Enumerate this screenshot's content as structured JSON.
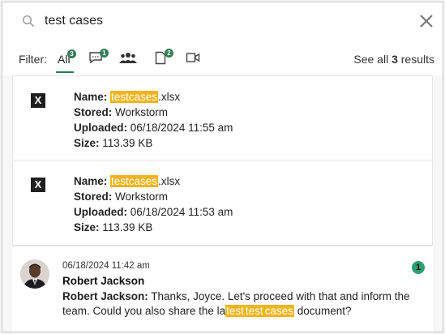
{
  "search": {
    "query": "test cases"
  },
  "filter": {
    "label": "Filter:",
    "all_label": "All",
    "all_count": "3",
    "messages_count": "1",
    "files_count": "2",
    "see_all_prefix": "See all",
    "see_all_count": "3",
    "see_all_suffix": "results"
  },
  "files": [
    {
      "name_label": "Name:",
      "name_highlight": "testcases",
      "name_ext": ".xlsx",
      "stored_label": "Stored:",
      "stored_value": "Workstorm",
      "uploaded_label": "Uploaded:",
      "uploaded_value": "06/18/2024 11:55 am",
      "size_label": "Size:",
      "size_value": "113.39 KB"
    },
    {
      "name_label": "Name:",
      "name_highlight": "testcases",
      "name_ext": ".xlsx",
      "stored_label": "Stored:",
      "stored_value": "Workstorm",
      "uploaded_label": "Uploaded:",
      "uploaded_value": "06/18/2024 11:53 am",
      "size_label": "Size:",
      "size_value": "113.39 KB"
    }
  ],
  "message": {
    "timestamp": "06/18/2024 11:42 am",
    "sender": "Robert Jackson",
    "body_sender": "Robert Jackson:",
    "body_text": "Thanks, Joyce. Let's proceed with that and inform the team. Could you also share the la",
    "body_hl1": "test",
    "body_hl2": "test",
    "body_hl3": "cases",
    "body_tail": "document?",
    "unread_count": "1"
  },
  "colors": {
    "accent": "#2f7d57",
    "highlight": "#f2b418"
  }
}
